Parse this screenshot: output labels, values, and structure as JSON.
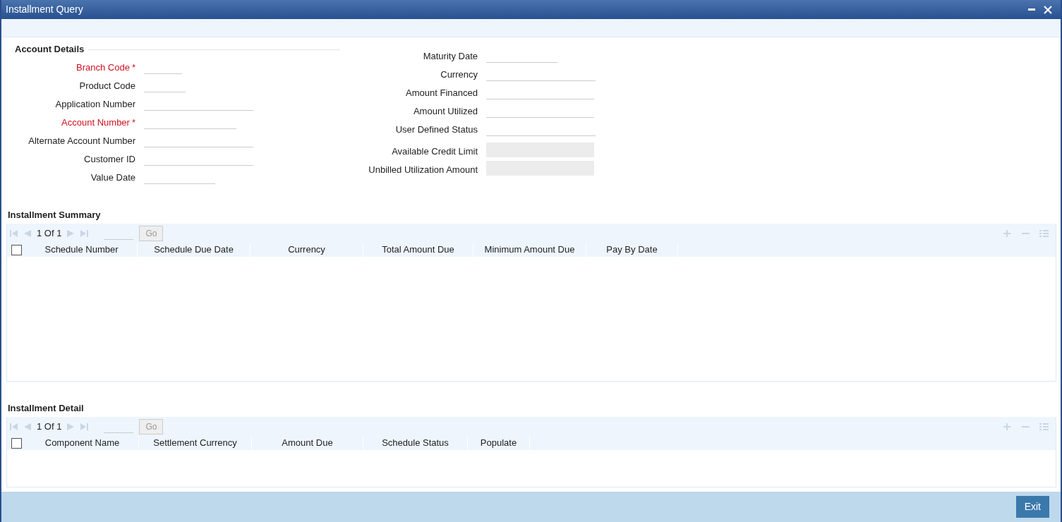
{
  "window": {
    "title": "Installment Query"
  },
  "account_details": {
    "title": "Account Details",
    "left_fields": [
      {
        "label": "Branch Code",
        "required": true,
        "required_mark": "*",
        "disabled": false
      },
      {
        "label": "Product Code",
        "required": false,
        "disabled": false
      },
      {
        "label": "Application Number",
        "required": false,
        "disabled": false
      },
      {
        "label": "Account Number",
        "required": true,
        "required_mark": "*",
        "disabled": false
      },
      {
        "label": "Alternate Account Number",
        "required": false,
        "disabled": false
      },
      {
        "label": "Customer ID",
        "required": false,
        "disabled": false
      },
      {
        "label": "Value Date",
        "required": false,
        "disabled": false
      }
    ],
    "right_fields": [
      {
        "label": "Maturity Date",
        "required": false,
        "disabled": false
      },
      {
        "label": "Currency",
        "required": false,
        "disabled": false
      },
      {
        "label": "Amount Financed",
        "required": false,
        "disabled": false
      },
      {
        "label": "Amount Utilized",
        "required": false,
        "disabled": false
      },
      {
        "label": "User Defined Status",
        "required": false,
        "disabled": false
      },
      {
        "label": "Available Credit Limit",
        "required": false,
        "disabled": true
      },
      {
        "label": "Unbilled Utilization Amount",
        "required": false,
        "disabled": true
      }
    ]
  },
  "grids": [
    {
      "title": "Installment Summary",
      "pager": "1 Of 1",
      "go_button": "Go",
      "select_all_checked": false,
      "columns": [
        "Schedule Number",
        "Schedule Due Date",
        "Currency",
        "Total Amount Due",
        "Minimum Amount Due",
        "Pay By Date"
      ]
    },
    {
      "title": "Installment Detail",
      "pager": "1 Of 1",
      "go_button": "Go",
      "select_all_checked": false,
      "columns": [
        "Component Name",
        "Settlement Currency",
        "Amount Due",
        "Schedule Status",
        "Populate"
      ]
    }
  ],
  "footer": {
    "exit_button": "Exit"
  }
}
